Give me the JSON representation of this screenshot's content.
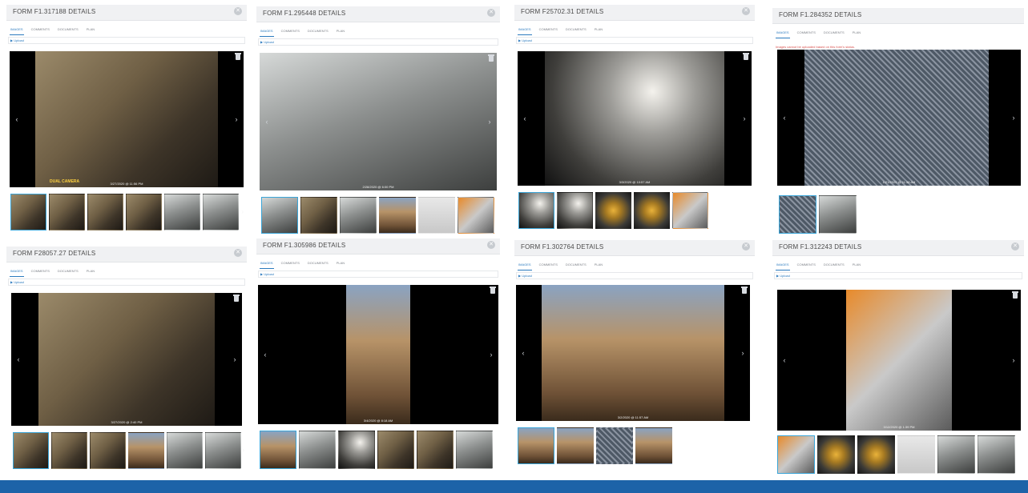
{
  "tabs": [
    "IMAGES",
    "COMMENTS",
    "DOCUMENTS",
    "PLAN"
  ],
  "upload_label": "Upload",
  "nav": {
    "prev": "‹",
    "next": "›",
    "more": "›"
  },
  "panels": [
    {
      "title": "FORM F1.317188 DETAILS",
      "stamp": "3/27/2020 @ 11:56 PM",
      "camera_text": "DUAL CAMERA",
      "warning": ""
    },
    {
      "title": "FORM F1.295448 DETAILS",
      "stamp": "2/28/2020 @ 6:00 PM",
      "camera_text": "",
      "warning": ""
    },
    {
      "title": "FORM F25702.31 DETAILS",
      "stamp": "3/3/2020 @ 10:57 AM",
      "camera_text": "",
      "warning": ""
    },
    {
      "title": "FORM F1.284352 DETAILS",
      "stamp": "1/21/2020 @ 11:38 AM",
      "camera_text": "",
      "warning": "Images cannot be uploaded based on this form's status."
    },
    {
      "title": "FORM F28057.27 DETAILS",
      "stamp": "3/27/2020 @ 2:40 PM",
      "camera_text": "",
      "warning": ""
    },
    {
      "title": "FORM F1.305986 DETAILS",
      "stamp": "3/4/2020 @ 8:18 AM",
      "camera_text": "",
      "warning": ""
    },
    {
      "title": "FORM F1.302764 DETAILS",
      "stamp": "3/2/2020 @ 11:57 AM",
      "camera_text": "",
      "warning": ""
    },
    {
      "title": "FORM F1.312243 DETAILS",
      "stamp": "3/12/2020 @ 1:39 PM",
      "camera_text": "",
      "warning": ""
    }
  ]
}
